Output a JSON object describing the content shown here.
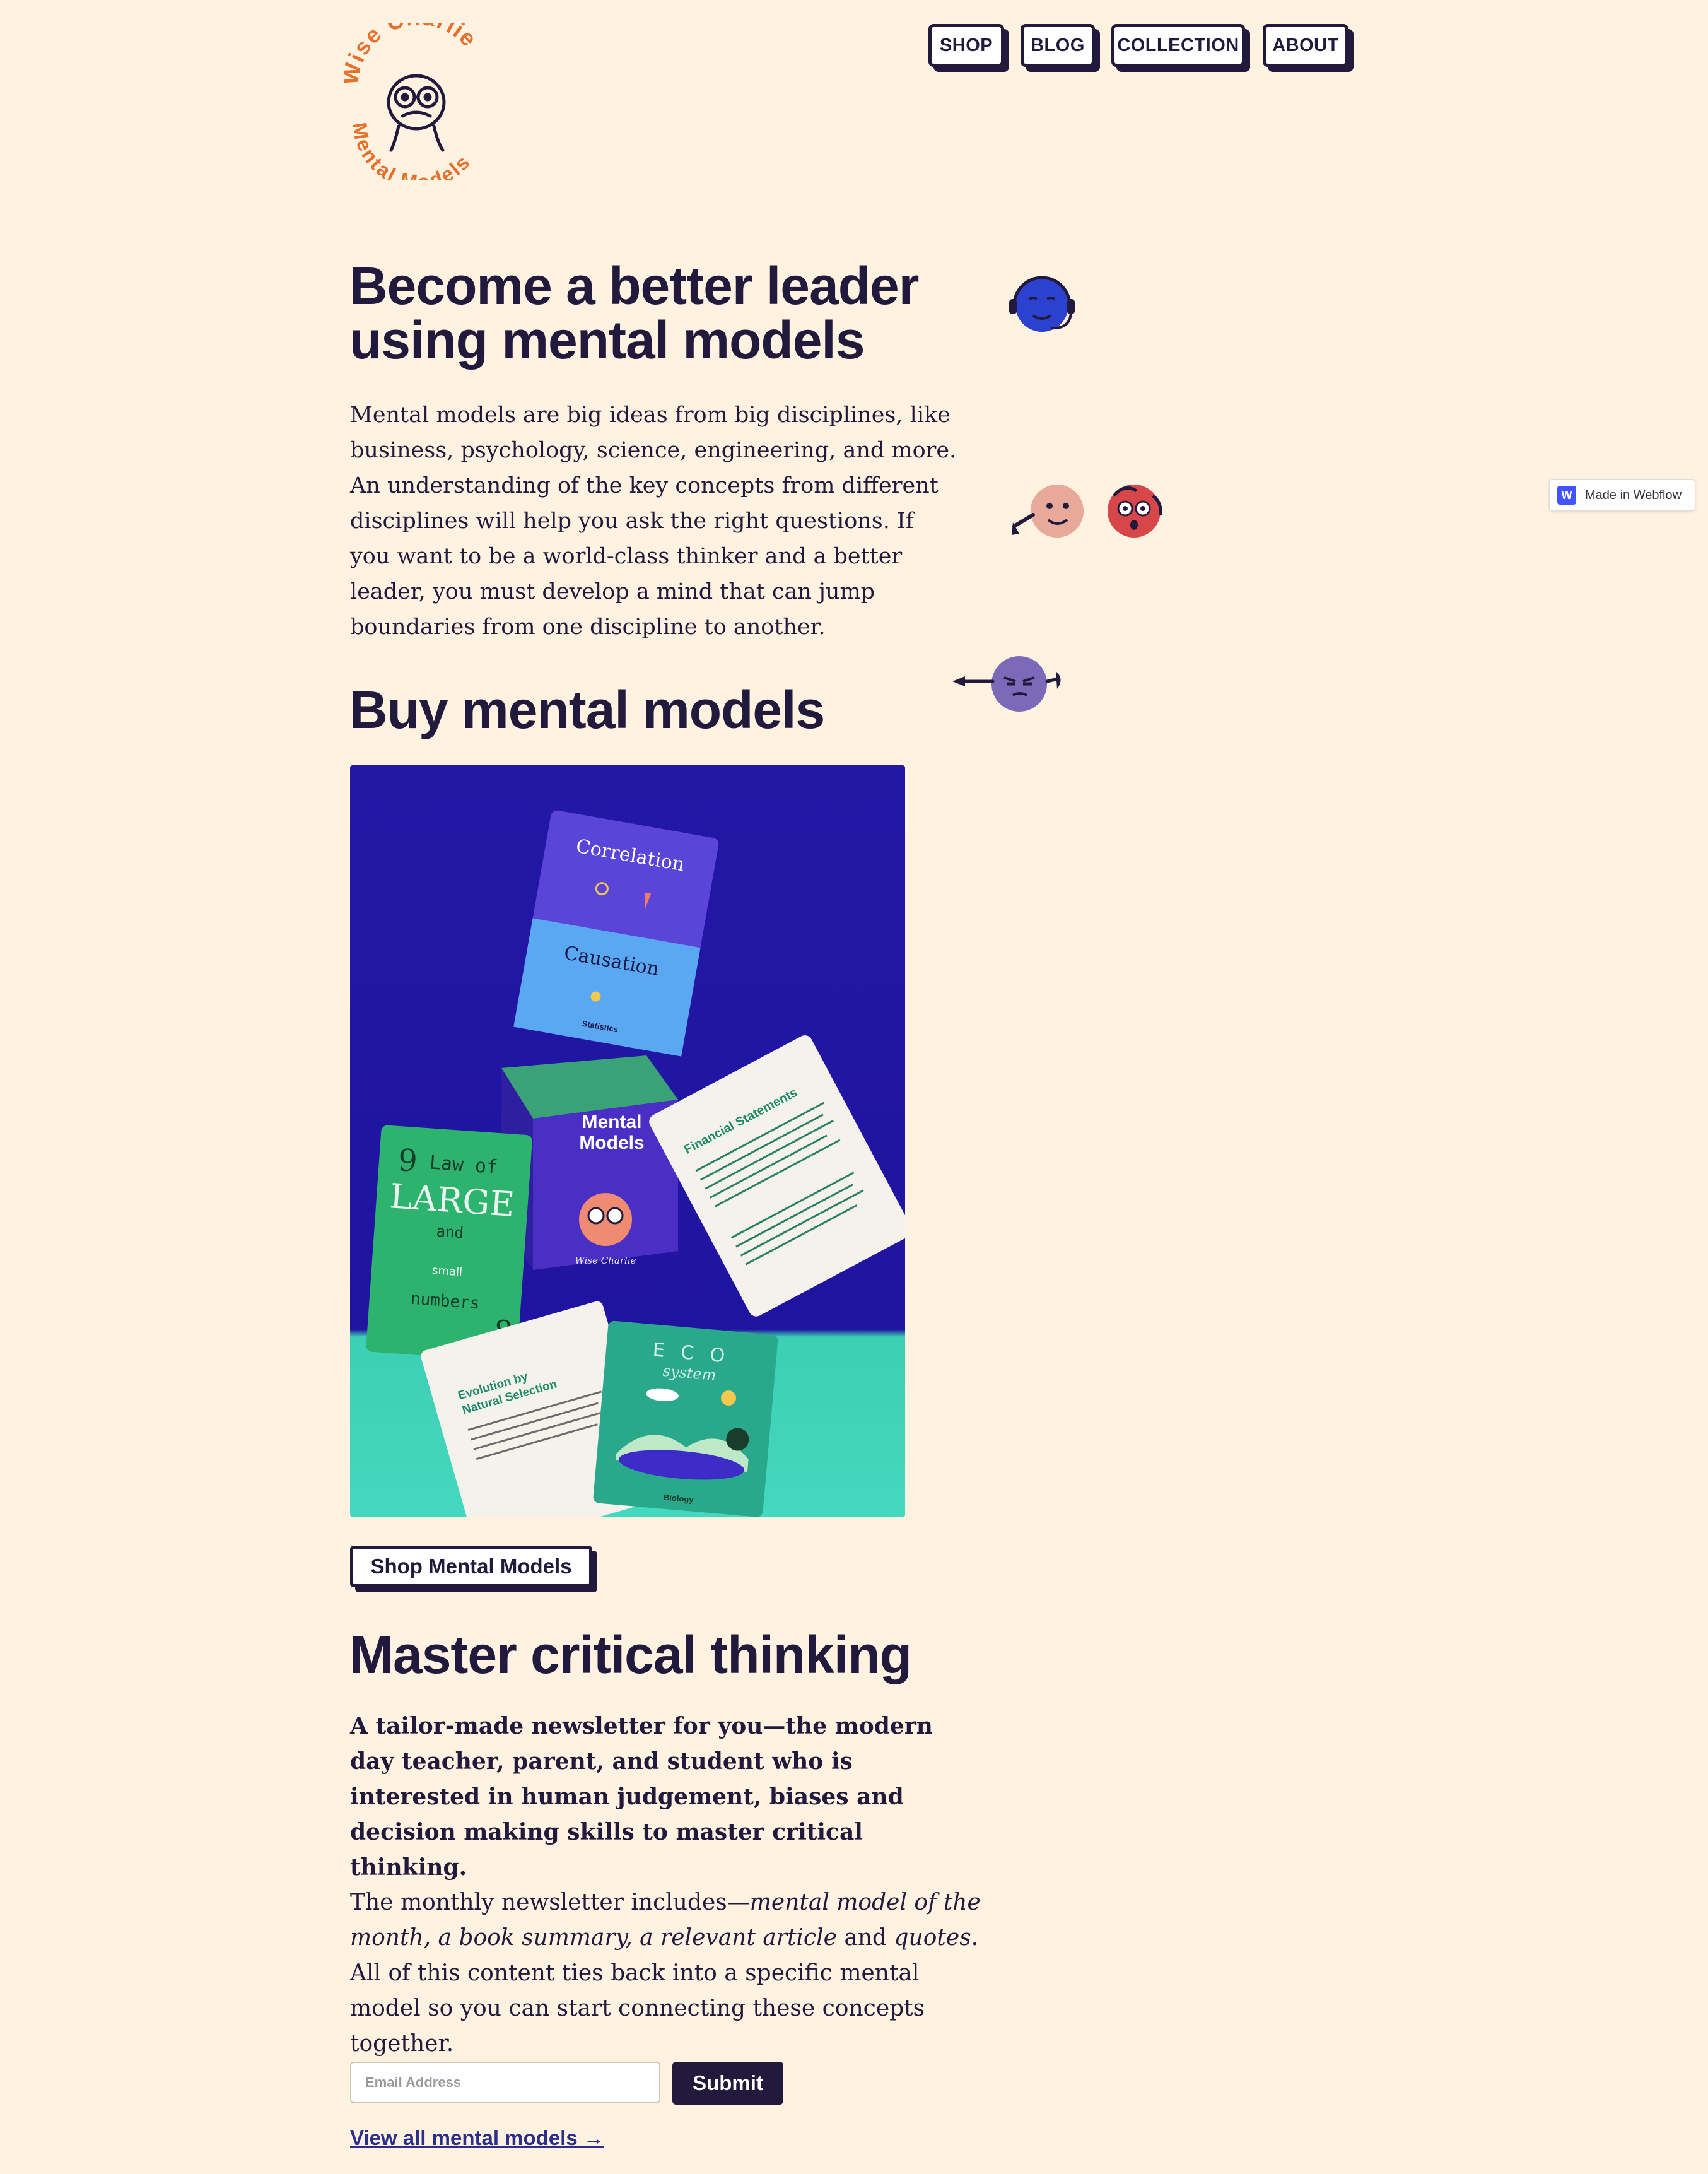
{
  "brand": {
    "name_top": "Wise Charlie",
    "name_bottom": "Mental Models",
    "accent": "#e5712d"
  },
  "nav": {
    "items": [
      {
        "label": "SHOP"
      },
      {
        "label": "BLOG"
      },
      {
        "label": "COLLECTION"
      },
      {
        "label": "ABOUT"
      }
    ]
  },
  "hero": {
    "title_line1": "Become a better leader",
    "title_line2": "using mental models",
    "paragraph": "Mental models are big ideas from big disciplines, like business, psychology, science, engineering, and more. An understanding of the key concepts from different disciplines will help you ask the right questions. If you want to be a world-class thinker and a better leader, you must develop a mind that can jump boundaries from one discipline to another."
  },
  "buy": {
    "heading": "Buy mental models",
    "cta_label": "Shop Mental Models",
    "cards": {
      "correlation": "Correlation",
      "causation": "Causation",
      "statistics": "Statistics",
      "box_title_1": "Mental",
      "box_title_2": "Models",
      "box_brand": "Wise Charlie",
      "law_1": "Law of",
      "law_2": "LARGE",
      "law_3": "and",
      "law_4": "small",
      "law_5": "numbers",
      "financial": "Financial Statements",
      "evolution_1": "Evolution by",
      "evolution_2": "Natural Selection",
      "eco_1": "E C O",
      "eco_2": "system",
      "biology": "Biology"
    }
  },
  "newsletter": {
    "heading": "Master critical thinking",
    "lead": "A tailor-made newsletter for you—the modern day teacher, parent, and student who is interested in human judgement, biases and decision making skills to master critical thinking.",
    "body_1": "The monthly newsletter includes—",
    "body_em_1": "mental model of the month, a book summary, a relevant article",
    "body_2": " and ",
    "body_em_2": "quotes",
    "body_3": ". All of this content ties back into a specific mental model so you can start connecting these concepts together.",
    "email_placeholder": "Email Address",
    "submit_label": "Submit",
    "view_all": "View all mental models →"
  },
  "badge": {
    "logo": "W",
    "label": "Made in Webflow"
  },
  "icons": {
    "headset_character": "headset-character-icon",
    "pen_character": "pen-character-icon",
    "alarmed_character": "alarmed-character-icon",
    "grumpy_character": "grumpy-character-icon"
  }
}
